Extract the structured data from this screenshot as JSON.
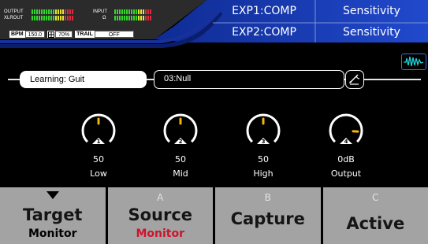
{
  "meters": {
    "output_label": "OUTPUT",
    "xlrout_label": "XLROUT",
    "input_label": "INPUT",
    "input_sub_label": "Ω"
  },
  "status": {
    "bpm_label": "BPM",
    "bpm_value": "150.0",
    "ratio_icon": "grid-icon",
    "percent_value": "70%",
    "trail_label": "TRAIL",
    "trail_value": "OFF"
  },
  "expression": {
    "exp1_label": "EXP1:COMP",
    "exp1_value": "Sensitivity",
    "exp2_label": "EXP2:COMP",
    "exp2_value": "Sensitivity"
  },
  "learning": {
    "label": "Learning: Guit",
    "capture_slot": "03:Null",
    "edit_icon": "edit-icon",
    "wave_icon": "waveform-icon"
  },
  "knobs": [
    {
      "number": "1",
      "value": "50",
      "label": "Low",
      "level": 0.5
    },
    {
      "number": "2",
      "value": "50",
      "label": "Mid",
      "level": 0.5
    },
    {
      "number": "3",
      "value": "50",
      "label": "High",
      "level": 0.5
    },
    {
      "number": "4",
      "value": "0dB",
      "label": "Output",
      "level": 0.85
    }
  ],
  "buttons": [
    {
      "letter": "",
      "main": "Target",
      "sub": "Monitor",
      "sub_color": "#000000",
      "selected": true
    },
    {
      "letter": "A",
      "main": "Source",
      "sub": "Monitor",
      "sub_color": "#d0132b",
      "selected": false
    },
    {
      "letter": "B",
      "main": "Capture",
      "sub": "",
      "sub_color": "#000000",
      "selected": false
    },
    {
      "letter": "C",
      "main": "Active",
      "sub": "",
      "sub_color": "#000000",
      "selected": false
    }
  ],
  "colors": {
    "accent_blue": "#1d3fb8",
    "knob_indicator": "#f2b600",
    "meter_green": "#34d52d",
    "meter_yellow": "#e8e62c",
    "meter_red": "#e1283c",
    "button_gray": "#a3a3a3"
  }
}
